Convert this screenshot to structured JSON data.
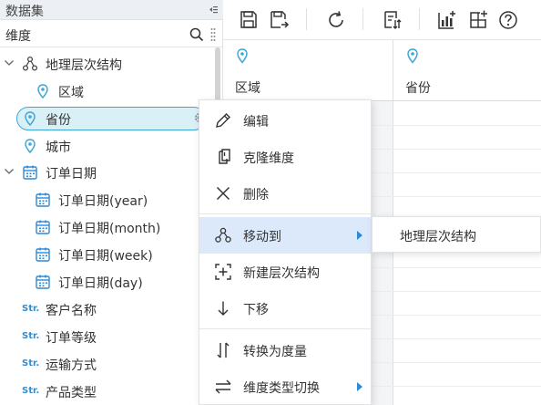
{
  "panel": {
    "title": "数据集",
    "search_label": "维度"
  },
  "tree": {
    "items": [
      {
        "label": "地理层次结构"
      },
      {
        "label": "区域"
      },
      {
        "label": "省份"
      },
      {
        "label": "城市"
      },
      {
        "label": "订单日期"
      },
      {
        "label": "订单日期(year)"
      },
      {
        "label": "订单日期(month)"
      },
      {
        "label": "订单日期(week)"
      },
      {
        "label": "订单日期(day)"
      },
      {
        "label": "客户名称",
        "type_badge": "Str."
      },
      {
        "label": "订单等级",
        "type_badge": "Str."
      },
      {
        "label": "运输方式",
        "type_badge": "Str."
      },
      {
        "label": "产品类型",
        "type_badge": "Str."
      }
    ]
  },
  "grid": {
    "columns": [
      {
        "label": "区域"
      },
      {
        "label": "省份"
      }
    ]
  },
  "context_menu": {
    "items": [
      {
        "label": "编辑",
        "icon": "pencil-icon"
      },
      {
        "label": "克隆维度",
        "icon": "clone-icon"
      },
      {
        "label": "删除",
        "icon": "close-icon"
      },
      {
        "label": "移动到",
        "icon": "hierarchy-icon",
        "has_submenu": true,
        "active": true
      },
      {
        "label": "新建层次结构",
        "icon": "add-hierarchy-icon"
      },
      {
        "label": "下移",
        "icon": "arrow-down-icon"
      },
      {
        "label": "转换为度量",
        "icon": "convert-icon"
      },
      {
        "label": "维度类型切换",
        "icon": "swap-icon",
        "has_submenu": true
      }
    ],
    "submenu_items": [
      {
        "label": "地理层次结构"
      }
    ]
  },
  "colors": {
    "accent": "#3da7d8",
    "selection_fill": "#d9f1f6",
    "menu_active": "#dbe9fb",
    "submenu_arrow": "#2b8ad8",
    "badge": "#2f8fd6"
  }
}
